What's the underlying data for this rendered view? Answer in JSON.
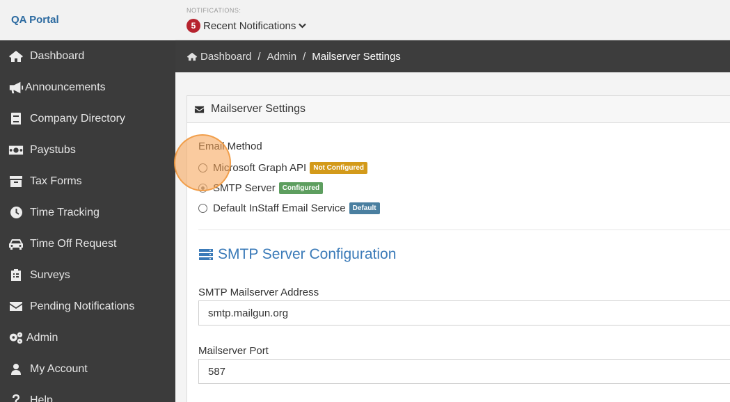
{
  "app": {
    "brand": "QA Portal"
  },
  "notifications": {
    "label": "NOTIFICATIONS:",
    "count": "5",
    "text": "Recent Notifications"
  },
  "sidebar": {
    "items": [
      {
        "label": "Dashboard",
        "icon": "home-icon"
      },
      {
        "label": "Announcements",
        "icon": "megaphone-icon"
      },
      {
        "label": "Company Directory",
        "icon": "book-icon"
      },
      {
        "label": "Paystubs",
        "icon": "money-icon"
      },
      {
        "label": "Tax Forms",
        "icon": "archive-icon"
      },
      {
        "label": "Time Tracking",
        "icon": "clock-icon"
      },
      {
        "label": "Time Off Request",
        "icon": "car-icon"
      },
      {
        "label": "Surveys",
        "icon": "clipboard-icon"
      },
      {
        "label": "Pending Notifications",
        "icon": "envelope-icon"
      },
      {
        "label": "Admin",
        "icon": "gears-icon"
      },
      {
        "label": "My Account",
        "icon": "user-icon"
      },
      {
        "label": "Help",
        "icon": "question-icon"
      }
    ]
  },
  "breadcrumb": {
    "home": "Dashboard",
    "sep1": "/",
    "admin": "Admin",
    "sep2": "/",
    "current": "Mailserver Settings"
  },
  "panel": {
    "title": "Mailserver Settings",
    "email_method_label": "Email Method",
    "options": [
      {
        "label": "Microsoft Graph API",
        "tag": "Not Configured",
        "tag_color": "#d39a1a",
        "checked": false
      },
      {
        "label": "SMTP Server",
        "tag": "Configured",
        "tag_color": "#5d9e5f",
        "checked": true
      },
      {
        "label": "Default InStaff Email Service",
        "tag": "Default",
        "tag_color": "#4a7fa0",
        "checked": false
      }
    ],
    "smtp_title": "SMTP Server Configuration",
    "address_label": "SMTP Mailserver Address",
    "address_value": "smtp.mailgun.org",
    "port_label": "Mailserver Port",
    "port_value": "587"
  },
  "colors": {
    "accent": "#3a7ab8",
    "sidebar_bg": "#3b3b3b",
    "highlight": "#f5a050"
  }
}
